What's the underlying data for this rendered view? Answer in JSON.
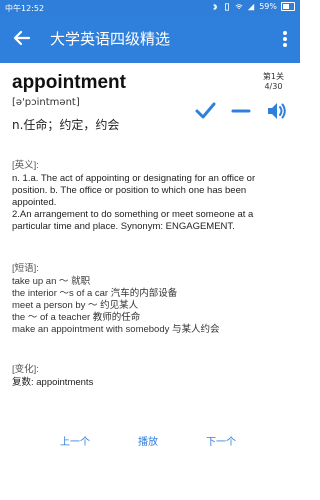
{
  "status": {
    "time": "中午12:52",
    "battery": "59%"
  },
  "app_bar": {
    "title": "大学英语四级精选"
  },
  "word": {
    "text": "appointment",
    "phonetic": "[ə'pɔintmənt]",
    "meaning": "n.任命；约定，约会",
    "progress_group": "第1关",
    "progress_count": "4/30"
  },
  "sections": {
    "english": {
      "header": "[英义]:",
      "body": " n. 1.a. The act of appointing or designating for an office or position. b. The office or position to which one has been appointed.\n2.An arrangement to do something or meet someone at a particular time and place. Synonym: ENGAGEMENT."
    },
    "phrases": {
      "header": "[短语]:",
      "items": [
        " take up an ～ 就职",
        "the interior ～s of a car 汽车的内部设备",
        "meet a person by ～ 约见某人",
        "the ～ of a teacher 教师的任命",
        "make an appointment with somebody    与某人约会"
      ]
    },
    "inflection": {
      "header": "[变化]:",
      "body": " 复数: appointments"
    }
  },
  "bottom": {
    "prev": "上一个",
    "play": "播放",
    "next": "下一个"
  },
  "colors": {
    "primary": "#2f80dd"
  },
  "icons": {
    "back": "back-arrow-icon",
    "menu": "more-vert-icon",
    "known": "check-icon",
    "skip": "minus-icon",
    "audio": "speaker-icon"
  }
}
